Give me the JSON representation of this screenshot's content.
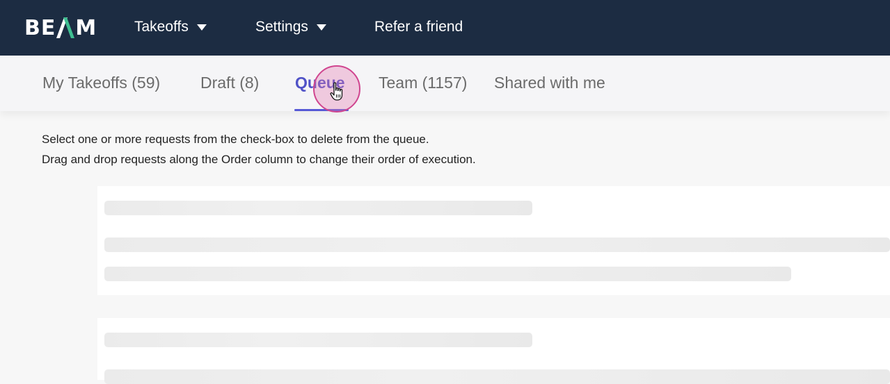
{
  "header": {
    "logo_text_left": "BE",
    "logo_text_right": "M",
    "logo_accent_color": "#3fbf91",
    "nav": [
      {
        "label": "Takeoffs",
        "has_dropdown": true
      },
      {
        "label": "Settings",
        "has_dropdown": true
      },
      {
        "label": "Refer a friend",
        "has_dropdown": false
      }
    ]
  },
  "tabs": [
    {
      "label": "My Takeoffs (59)",
      "active": false
    },
    {
      "label": "Draft (8)",
      "active": false
    },
    {
      "label": "Queue",
      "active": true
    },
    {
      "label": "Team (1157)",
      "active": false
    },
    {
      "label": "Shared with me",
      "active": false
    }
  ],
  "instructions": {
    "line1": "Select one or more requests from the check-box to delete from the queue.",
    "line2": "Drag and drop requests along the Order column to change their order of execution."
  },
  "content": {
    "state": "loading",
    "skeleton_cards": 2
  },
  "colors": {
    "topbar": "#1c2c42",
    "active_tab": "#5052c7",
    "cursor_highlight": "#d0458f"
  }
}
